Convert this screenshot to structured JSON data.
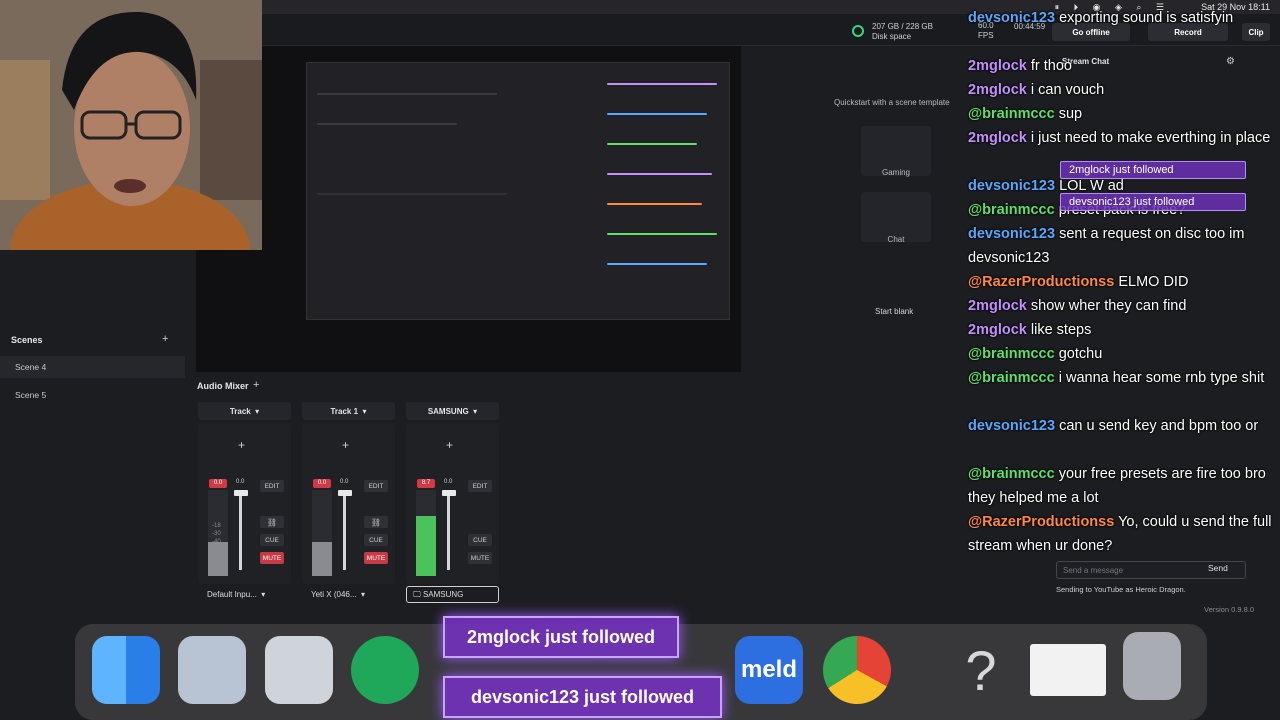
{
  "menubar": {
    "clock": "Sat 29 Nov 18:11",
    "icons": "⏸ ⏵ ◉ ◈ ⌕ ☰"
  },
  "topbar": {
    "disk_usage": "207 GB / 228 GB",
    "disk_label": "Disk space",
    "go_offline": "Go offline",
    "stream_time": "00:44:59",
    "record": "Record",
    "clip": "Clip",
    "fps_label": "FPS",
    "fps_value": "60.0"
  },
  "scenes": {
    "title": "Scenes",
    "add": "+",
    "items": [
      "Scene 4",
      "Scene 5"
    ]
  },
  "templates": {
    "title": "Quickstart with a scene template",
    "cards": [
      "Gaming",
      "Chat"
    ],
    "blank": "Start blank"
  },
  "mixer": {
    "title": "Audio Mixer",
    "add": "+",
    "tracks": [
      {
        "name": "Track",
        "level": "0.0",
        "gain": "0.0",
        "device": "Default Inpu...",
        "level_fraction": 0.0
      },
      {
        "name": "Track 1",
        "level": "0.0",
        "gain": "0.0",
        "device": "Yeti X (046...",
        "level_fraction": 0.0
      },
      {
        "name": "SAMSUNG",
        "level": "8.7",
        "gain": "0.0",
        "device": "SAMSUNG",
        "level_fraction": 0.7
      }
    ],
    "edit": "EDIT",
    "cue": "CUE",
    "mute": "MUTE",
    "scale": [
      "-18",
      "-30",
      "-40",
      "-50",
      "-54"
    ]
  },
  "chat": {
    "header": "Stream Chat",
    "messages": [
      {
        "user": "devsonic123",
        "color": "blue",
        "text": "exporting sound is satisfyin"
      },
      {
        "user": "2mglock",
        "color": "pink",
        "text": "fr thoo"
      },
      {
        "user": "2mglock",
        "color": "pink",
        "text": "i can vouch"
      },
      {
        "user": "@brainmccc",
        "color": "green",
        "text": "sup"
      },
      {
        "user": "2mglock",
        "color": "pink",
        "text": "i just need to make everthing in place"
      },
      {
        "user": "devsonic123",
        "color": "blue",
        "text": "LOL W ad"
      },
      {
        "user": "@brainmccc",
        "color": "green",
        "text": "preset pack is free?"
      },
      {
        "user": "devsonic123",
        "color": "blue",
        "text": "sent a request on disc too im devsonic123"
      },
      {
        "user": "@RazerProductionss",
        "color": "orange",
        "text": "ELMO DID"
      },
      {
        "user": "2mglock",
        "color": "pink",
        "text": "show wher they can find"
      },
      {
        "user": "2mglock",
        "color": "pink",
        "text": "like steps"
      },
      {
        "user": "@brainmccc",
        "color": "green",
        "text": "gotchu"
      },
      {
        "user": "@brainmccc",
        "color": "green",
        "text": "i wanna hear some rnb type shit"
      },
      {
        "user": "devsonic123",
        "color": "blue",
        "text": "can u send key and bpm too or"
      },
      {
        "user": "@brainmccc",
        "color": "green",
        "text": "your free presets are fire too bro they helped me a lot"
      },
      {
        "user": "@RazerProductionss",
        "color": "orange",
        "text": "Yo, could u send the full stream when ur done?"
      }
    ],
    "follows": [
      "2mglock just followed",
      "devsonic123 just followed"
    ],
    "input_placeholder": "Send a message",
    "send": "Send",
    "footer": "Sending to YouTube as Heroic Dragon.",
    "version": "Version 0.9.8.0"
  },
  "dock_follows": [
    "2mglock just followed",
    "devsonic123 just followed"
  ],
  "dock_icons": [
    "finder-icon",
    "quicktime-icon",
    "launchpad-icon",
    "app-icon",
    "meld-icon",
    "chrome-icon",
    "help-icon",
    "preview-icon",
    "trash-icon"
  ],
  "dock_meld_label": "meld"
}
